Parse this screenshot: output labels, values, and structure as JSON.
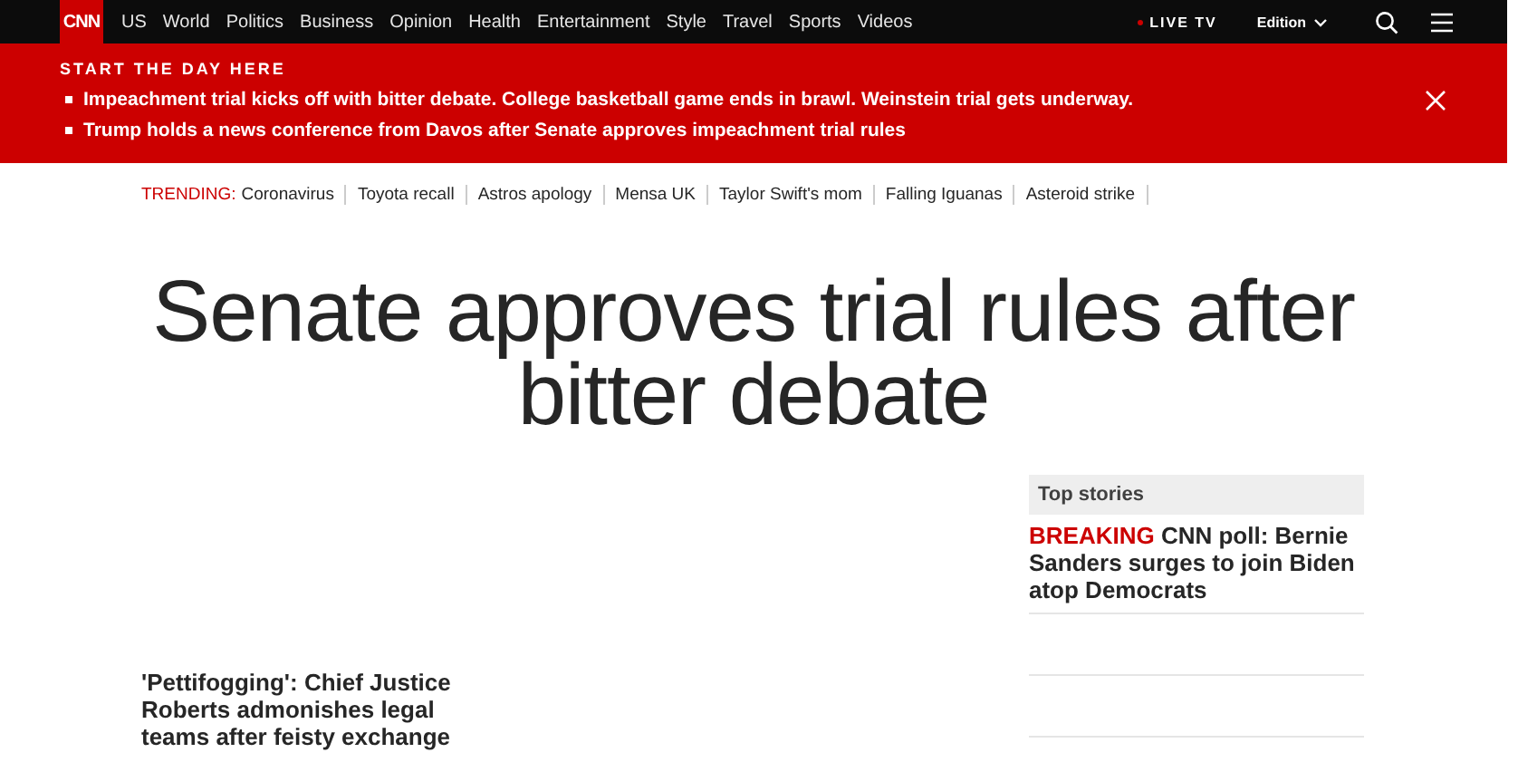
{
  "nav": {
    "logo": "CNN",
    "links": [
      "US",
      "World",
      "Politics",
      "Business",
      "Opinion",
      "Health",
      "Entertainment",
      "Style",
      "Travel",
      "Sports",
      "Videos"
    ],
    "live_tv": "LIVE TV",
    "edition": "Edition"
  },
  "banner": {
    "heading": "START THE DAY HERE",
    "items": [
      "Impeachment trial kicks off with bitter debate. College basketball game ends in brawl. Weinstein trial gets underway.",
      "Trump holds a news conference from Davos after Senate approves impeachment trial rules"
    ]
  },
  "trending": {
    "label": "TRENDING:",
    "items": [
      "Coronavirus",
      "Toyota recall",
      "Astros apology",
      "Mensa UK",
      "Taylor Swift's mom",
      "Falling Iguanas",
      "Asteroid strike"
    ]
  },
  "headline": "Senate approves trial rules after bitter debate",
  "lead_story": "'Pettifogging': Chief Justice Roberts admonishes legal teams after feisty exchange",
  "top_stories": {
    "title": "Top stories",
    "items": [
      {
        "label": "BREAKING",
        "text": "CNN poll: Bernie Sanders surges to join Biden atop Democrats"
      }
    ]
  }
}
